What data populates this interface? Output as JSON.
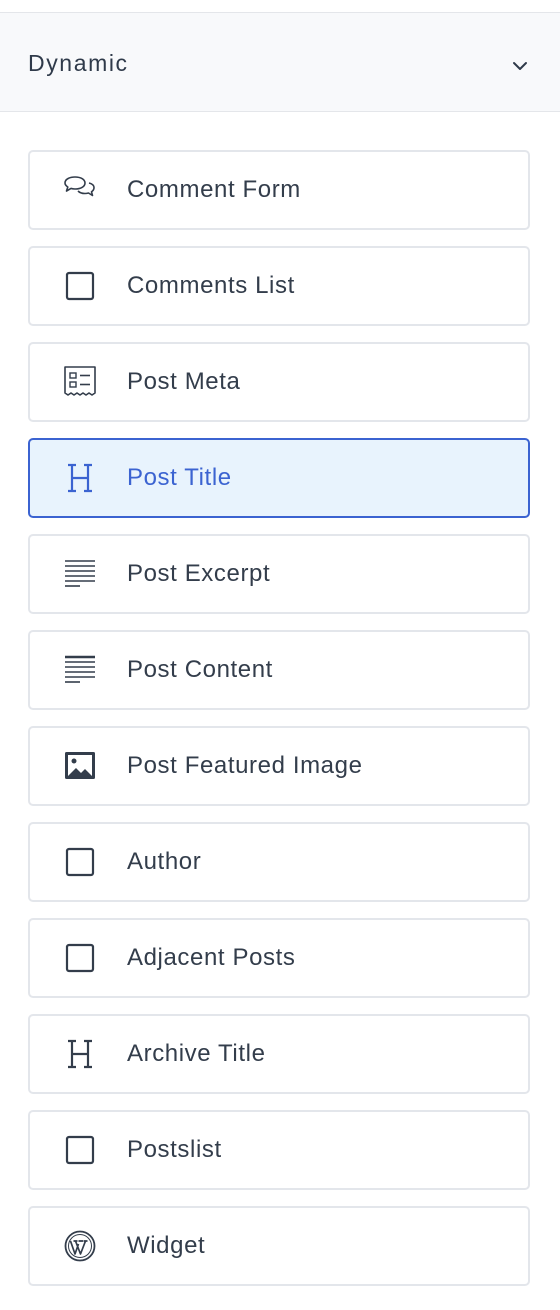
{
  "panel": {
    "section_title": "Dynamic",
    "collapse_icon": "chevron-down-icon"
  },
  "blocks": [
    {
      "label": "Comment Form",
      "icon": "comments-icon",
      "selected": false
    },
    {
      "label": "Comments List",
      "icon": "square-icon",
      "selected": false
    },
    {
      "label": "Post Meta",
      "icon": "post-meta-icon",
      "selected": false
    },
    {
      "label": "Post Title",
      "icon": "heading-icon",
      "selected": true
    },
    {
      "label": "Post Excerpt",
      "icon": "text-lines-icon",
      "selected": false
    },
    {
      "label": "Post Content",
      "icon": "text-lines-icon",
      "selected": false
    },
    {
      "label": "Post Featured Image",
      "icon": "image-icon",
      "selected": false
    },
    {
      "label": "Author",
      "icon": "square-icon",
      "selected": false
    },
    {
      "label": "Adjacent Posts",
      "icon": "square-icon",
      "selected": false
    },
    {
      "label": "Archive Title",
      "icon": "heading-icon",
      "selected": false
    },
    {
      "label": "Postslist",
      "icon": "square-icon",
      "selected": false
    },
    {
      "label": "Widget",
      "icon": "wordpress-icon",
      "selected": false
    }
  ],
  "colors": {
    "accent": "#3b63d1",
    "selected_background": "#e8f3fd",
    "text": "#333d4b",
    "border": "#e3e6eb"
  }
}
